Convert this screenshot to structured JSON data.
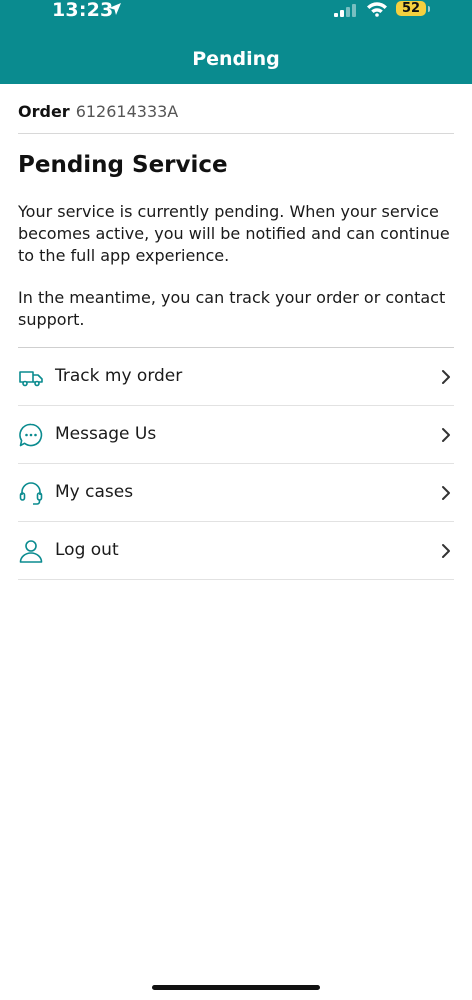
{
  "status_bar": {
    "time": "13:23",
    "battery": "52"
  },
  "header": {
    "title": "Pending"
  },
  "order": {
    "label": "Order",
    "number": "612614333A"
  },
  "content": {
    "title": "Pending Service",
    "paragraph1": "Your service is currently pending. When your service becomes active, you will be notified and can continue to the full app experience.",
    "paragraph2": "In the meantime, you can track your order or contact support."
  },
  "menu": {
    "items": [
      {
        "label": "Track my order",
        "icon": "truck-icon"
      },
      {
        "label": "Message Us",
        "icon": "chat-bubble-icon"
      },
      {
        "label": "My cases",
        "icon": "headset-icon"
      },
      {
        "label": "Log out",
        "icon": "person-icon"
      }
    ]
  },
  "colors": {
    "brand": "#0a8b8f",
    "battery": "#f4d03f"
  }
}
